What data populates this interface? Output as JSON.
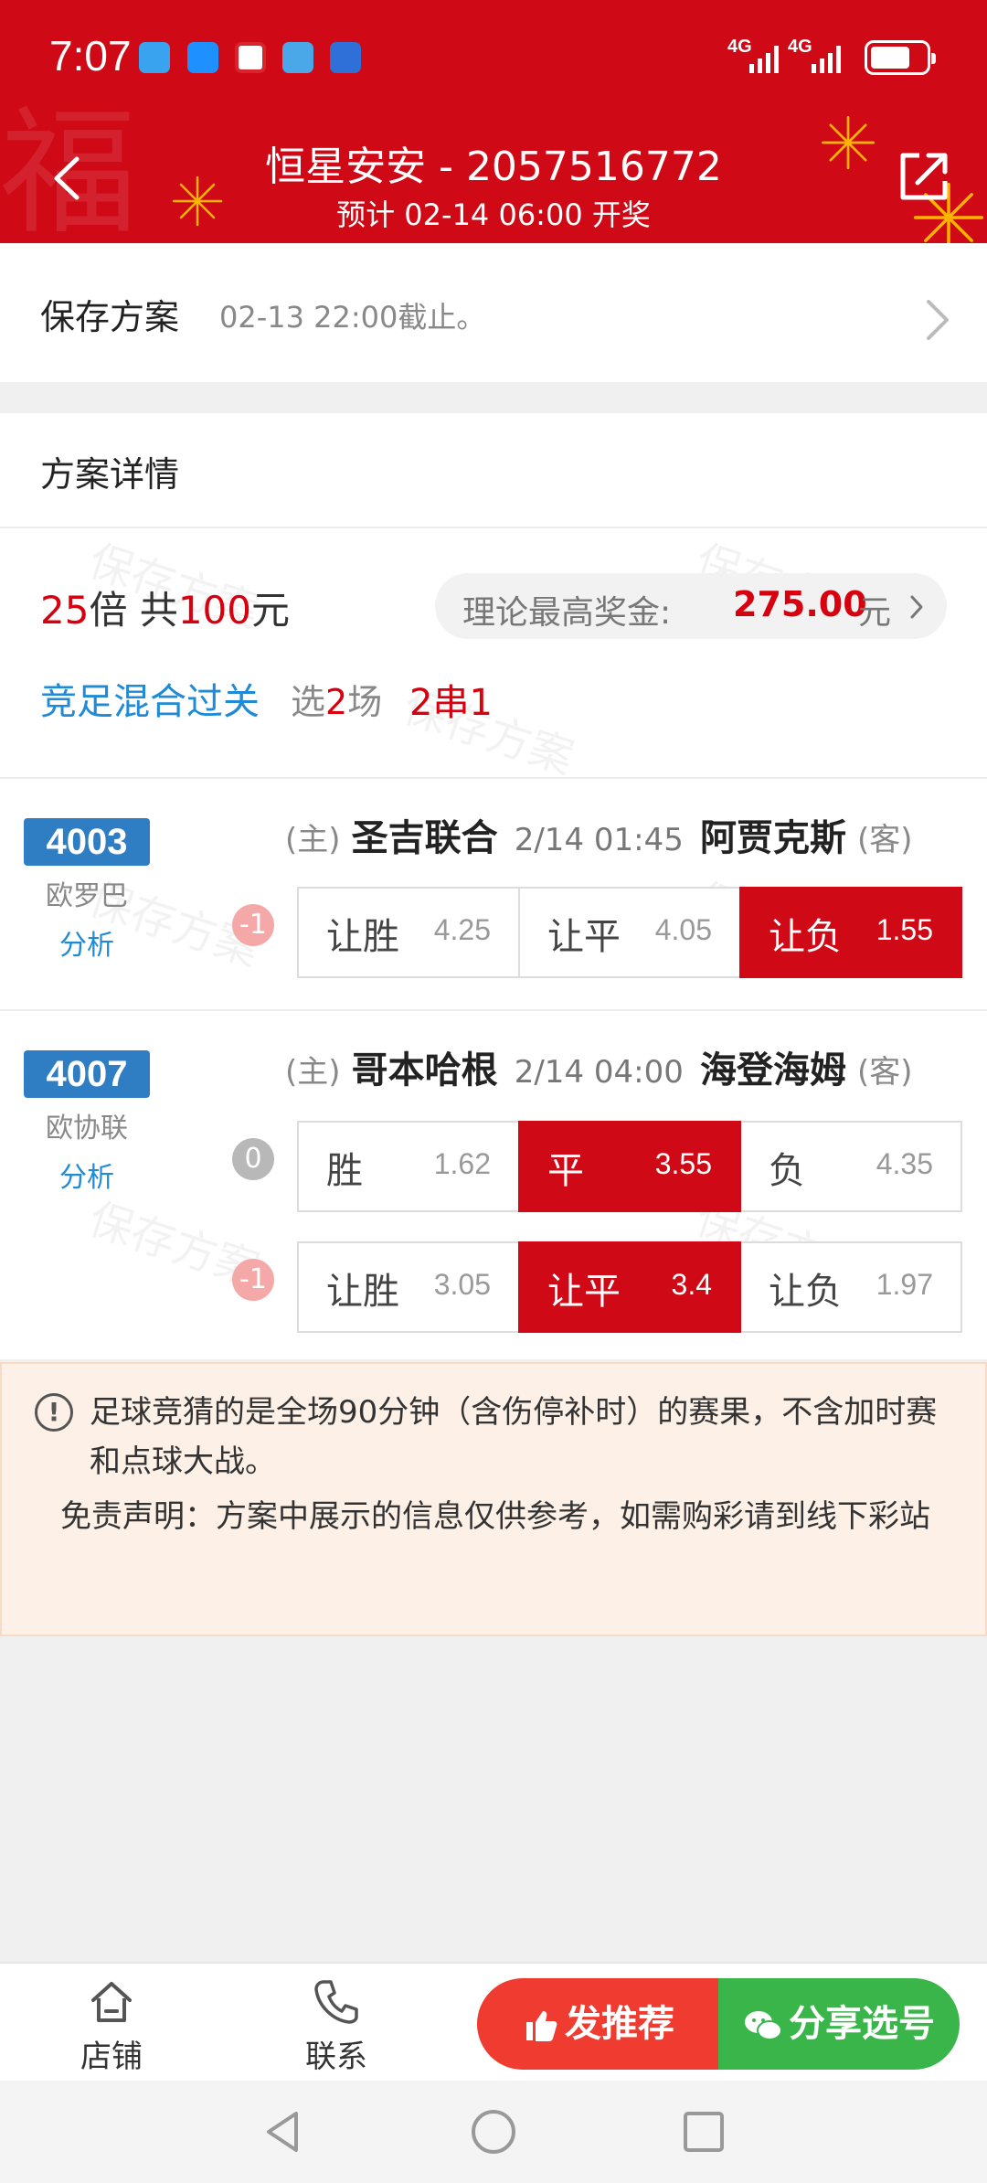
{
  "status_bar": {
    "time": "7:07",
    "signal_1": "4G",
    "signal_2": "4G",
    "notif_colors": [
      "#3aa3f0",
      "#1e90ff",
      "#d9232d",
      "#4aa8e8",
      "#2e6fd8"
    ],
    "battery_level": 0.6
  },
  "header": {
    "title": "恒星安安 - 2057516772",
    "subtitle": "预计 02-14 06:00 开奖",
    "back_icon": "chevron-left-icon",
    "share_icon": "share-icon"
  },
  "save": {
    "title": "保存方案",
    "note": "02-13 22:00截止。"
  },
  "detail": {
    "section_title": "方案详情",
    "watermark": "保存方案",
    "multiple": "25",
    "multiple_unit": "倍 共",
    "total": "100",
    "total_unit": "元",
    "prize_label": "理论最高奖金:",
    "prize_amount": "275.00",
    "prize_unit": "元",
    "play_type": "竞足混合过关",
    "pick_prefix": "选",
    "pick_count": "2",
    "pick_suffix": "场",
    "pass_type": "2串1"
  },
  "matches": [
    {
      "number": "4003",
      "league": "欧罗巴",
      "analysis": "分析",
      "home_tag": "(主)",
      "home": "圣吉联合",
      "time": "2/14 01:45",
      "away": "阿贾克斯",
      "away_tag": "(客)",
      "rows": [
        {
          "handicap": "-1",
          "cells": [
            {
              "name": "让胜",
              "odds": "4.25",
              "selected": false
            },
            {
              "name": "让平",
              "odds": "4.05",
              "selected": false
            },
            {
              "name": "让负",
              "odds": "1.55",
              "selected": true
            }
          ]
        }
      ]
    },
    {
      "number": "4007",
      "league": "欧协联",
      "analysis": "分析",
      "home_tag": "(主)",
      "home": "哥本哈根",
      "time": "2/14 04:00",
      "away": "海登海姆",
      "away_tag": "(客)",
      "rows": [
        {
          "handicap": "0",
          "cells": [
            {
              "name": "胜",
              "odds": "1.62",
              "selected": false
            },
            {
              "name": "平",
              "odds": "3.55",
              "selected": true
            },
            {
              "name": "负",
              "odds": "4.35",
              "selected": false
            }
          ]
        },
        {
          "handicap": "-1",
          "cells": [
            {
              "name": "让胜",
              "odds": "3.05",
              "selected": false
            },
            {
              "name": "让平",
              "odds": "3.4",
              "selected": true
            },
            {
              "name": "让负",
              "odds": "1.97",
              "selected": false
            }
          ]
        }
      ]
    }
  ],
  "notice": {
    "rule": "足球竞猜的是全场90分钟（含伤停补时）的赛果，不含加时赛和点球大战。",
    "disclaimer": "免责声明：方案中展示的信息仅供参考，如需购彩请到线下彩站"
  },
  "bottom_bar": {
    "shop": "店铺",
    "contact": "联系",
    "recommend": "发推荐",
    "share": "分享选号"
  },
  "colors": {
    "brand_red": "#cf0a16",
    "accent_blue": "#1f8ad6",
    "share_green": "#39b54a",
    "recommend_red": "#ef3b30"
  }
}
